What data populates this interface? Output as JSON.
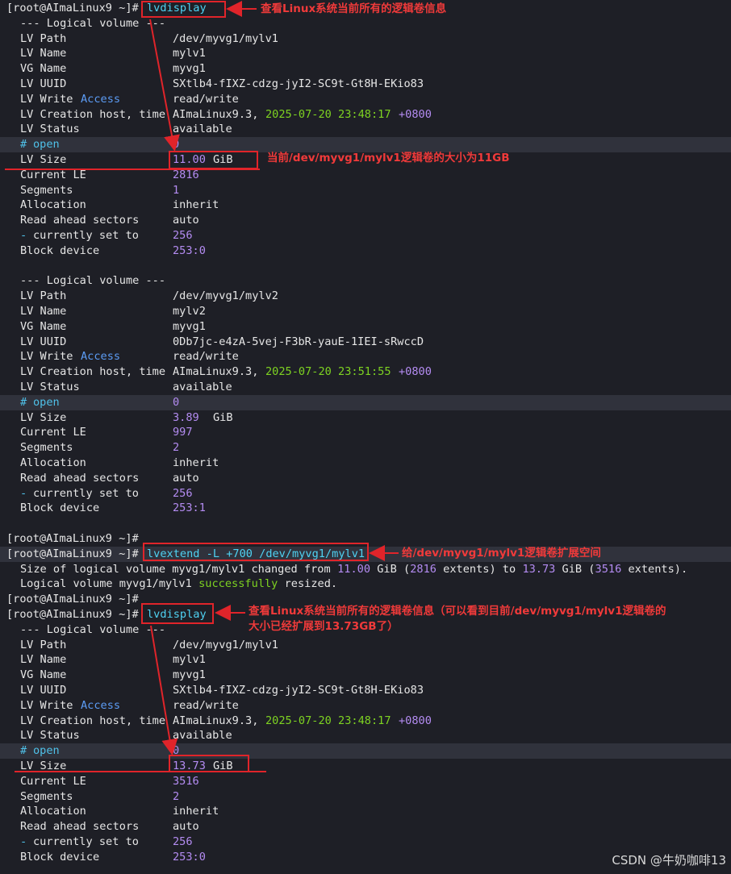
{
  "prompt": "[root@AImaLinux9 ~]#",
  "commands": {
    "lvdisplay": "lvdisplay",
    "lvextend": "lvextend -L +700 /dev/myvg1/mylv1"
  },
  "labels": {
    "header": "--- Logical volume ---",
    "lv_path": "LV Path",
    "lv_name": "LV Name",
    "vg_name": "VG Name",
    "lv_uuid": "LV UUID",
    "lv_write": "LV Write",
    "access": "Access",
    "lv_creation": "LV Creation host, time",
    "lv_status": "LV Status",
    "hash": "#",
    "open": "open",
    "lv_size": "LV Size",
    "current_le": "Current LE",
    "segments": "Segments",
    "allocation": "Allocation",
    "read_ahead": "Read ahead sectors",
    "dash": "-",
    "currently_set_to": "currently set to",
    "block_device": "Block device",
    "gib": "GiB"
  },
  "volumes": [
    {
      "path": "/dev/myvg1/mylv1",
      "name": "mylv1",
      "vg": "myvg1",
      "uuid": "SXtlb4-fIXZ-cdzg-jyI2-SC9t-Gt8H-EKio83",
      "write": "read/write",
      "host": "AImaLinux9.3,",
      "date": "2025-07-20 23:48:17",
      "tz": "+0800",
      "status": "available",
      "open": "0",
      "size": "11.00",
      "current_le": "2816",
      "segments": "1",
      "allocation": "inherit",
      "read_ahead": "auto",
      "set_to": "256",
      "block": "253:0"
    },
    {
      "path": "/dev/myvg1/mylv2",
      "name": "mylv2",
      "vg": "myvg1",
      "uuid": "0Db7jc-e4zA-5vej-F3bR-yauE-1IEI-sRwccD",
      "write": "read/write",
      "host": "AImaLinux9.3,",
      "date": "2025-07-20 23:51:55",
      "tz": "+0800",
      "status": "available",
      "open": "0",
      "size": "3.89",
      "current_le": "997",
      "segments": "2",
      "allocation": "inherit",
      "read_ahead": "auto",
      "set_to": "256",
      "block": "253:1"
    },
    {
      "path": "/dev/myvg1/mylv1",
      "name": "mylv1",
      "vg": "myvg1",
      "uuid": "SXtlb4-fIXZ-cdzg-jyI2-SC9t-Gt8H-EKio83",
      "write": "read/write",
      "host": "AImaLinux9.3,",
      "date": "2025-07-20 23:48:17",
      "tz": "+0800",
      "status": "available",
      "open": "0",
      "size": "13.73",
      "current_le": "3516",
      "segments": "2",
      "allocation": "inherit",
      "read_ahead": "auto",
      "set_to": "256",
      "block": "253:0"
    }
  ],
  "extend_output": {
    "p1": "Size of logical volume myvg1/mylv1 changed from ",
    "from_size": "11.00",
    "p2": " GiB (",
    "from_ext": "2816",
    "p3": " extents) to ",
    "to_size": "13.73",
    "p4": " GiB (",
    "to_ext": "3516",
    "p5": " extents).",
    "r1": "Logical volume myvg1/mylv1 ",
    "successfully": "successfully",
    "r2": " resized."
  },
  "annotations": {
    "a1": "查看Linux系统当前所有的逻辑卷信息",
    "a2": "当前/dev/myvg1/mylv1逻辑卷的大小为11GB",
    "a3": "给/dev/myvg1/mylv1逻辑卷扩展空间",
    "a4_line1": "查看Linux系统当前所有的逻辑卷信息（可以看到目前/dev/myvg1/mylv1逻辑卷的",
    "a4_line2": "大小已经扩展到13.73GB了）"
  },
  "watermark": "CSDN @牛奶咖啡13",
  "colors": {
    "background": "#1e1f26",
    "text": "#e6e6e6",
    "command": "#4fd2f2",
    "number": "#b48cf2",
    "success": "#7ed321",
    "annotation": "#e0242a"
  }
}
